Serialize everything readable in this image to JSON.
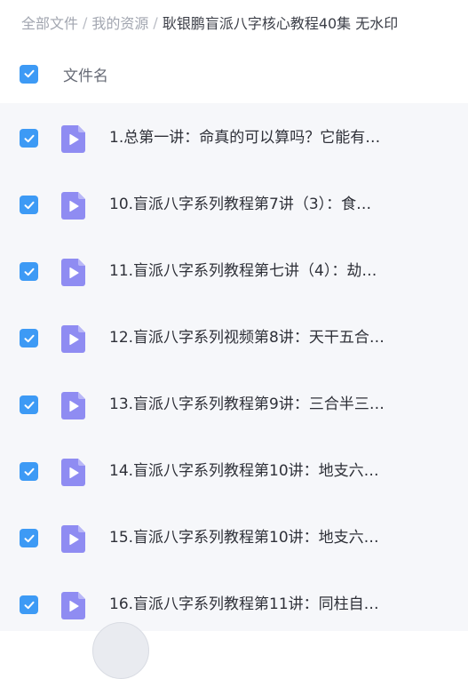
{
  "breadcrumb": {
    "items": [
      "全部文件",
      "我的资源"
    ],
    "separator": "/",
    "current": "耿银鹏盲派八字核心教程40集 无水印"
  },
  "header": {
    "select_all_checked": true,
    "column_label": "文件名"
  },
  "files": [
    {
      "name": "1.总第一讲：命真的可以算吗？它能有…",
      "checked": true,
      "icon": "video-file-icon"
    },
    {
      "name": "10.盲派八字系列教程第7讲（3）：食…",
      "checked": true,
      "icon": "video-file-icon"
    },
    {
      "name": "11.盲派八字系列教程第七讲（4）：劫…",
      "checked": true,
      "icon": "video-file-icon"
    },
    {
      "name": "12.盲派八字系列视频第8讲：天干五合…",
      "checked": true,
      "icon": "video-file-icon"
    },
    {
      "name": "13.盲派八字系列教程第9讲：三合半三…",
      "checked": true,
      "icon": "video-file-icon"
    },
    {
      "name": "14.盲派八字系列教程第10讲：地支六…",
      "checked": true,
      "icon": "video-file-icon"
    },
    {
      "name": "15.盲派八字系列教程第10讲：地支六…",
      "checked": true,
      "icon": "video-file-icon"
    },
    {
      "name": "16.盲派八字系列教程第11讲：同柱自…",
      "checked": true,
      "icon": "video-file-icon"
    }
  ],
  "colors": {
    "checkbox_accent": "#3d9af5",
    "file_icon": "#8f8cf2",
    "list_background": "#f6f7fa"
  }
}
